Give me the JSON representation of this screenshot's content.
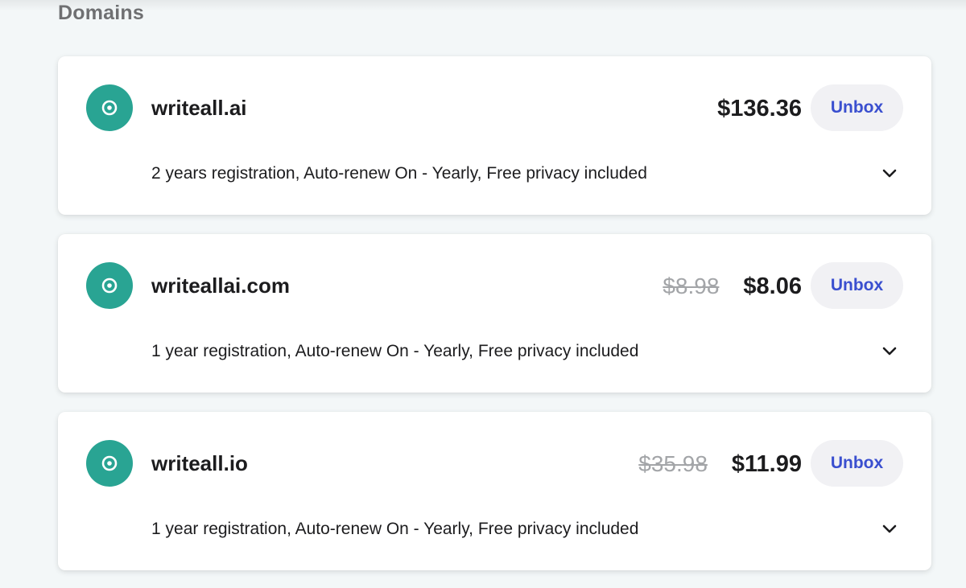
{
  "section": {
    "title": "Domains"
  },
  "domains": [
    {
      "name": "writeall.ai",
      "old_price": "",
      "price": "$136.36",
      "button_label": "Unbox",
      "details": "2 years registration, Auto-renew On - Yearly, Free privacy included",
      "icon": "domain-target-icon",
      "expand_icon": "chevron-down-icon"
    },
    {
      "name": "writeallai.com",
      "old_price": "$8.98",
      "price": "$8.06",
      "button_label": "Unbox",
      "details": "1 year registration, Auto-renew On - Yearly, Free privacy included",
      "icon": "domain-target-icon",
      "expand_icon": "chevron-down-icon"
    },
    {
      "name": "writeall.io",
      "old_price": "$35.98",
      "price": "$11.99",
      "button_label": "Unbox",
      "details": "1 year registration, Auto-renew On - Yearly, Free privacy included",
      "icon": "domain-target-icon",
      "expand_icon": "chevron-down-icon"
    }
  ],
  "colors": {
    "icon_bg": "#29a493",
    "button_bg": "#f1f1f4",
    "button_text": "#3a4fcf",
    "old_price": "#a3a5a8",
    "page_bg": "#f3f7f8"
  }
}
